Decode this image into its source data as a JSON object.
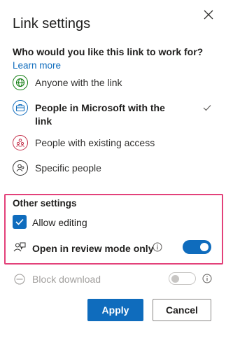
{
  "dialog": {
    "title": "Link settings",
    "question": "Who would you like this link to work for?",
    "learn_more": "Learn more"
  },
  "options": [
    {
      "label": "Anyone with the link",
      "icon": "globe-icon",
      "color": "#107c10",
      "selected": false
    },
    {
      "label": "People in Microsoft with the link",
      "icon": "briefcase-icon",
      "color": "#0f6cbd",
      "selected": true
    },
    {
      "label": "People with existing access",
      "icon": "people-group-icon",
      "color": "#c4314b",
      "selected": false
    },
    {
      "label": "Specific people",
      "icon": "person-icon",
      "color": "#323130",
      "selected": false
    }
  ],
  "other_settings": {
    "heading": "Other settings",
    "allow_editing": {
      "label": "Allow editing",
      "checked": true
    },
    "review_mode": {
      "label": "Open in review mode only",
      "on": true
    },
    "block_download": {
      "label": "Block download",
      "on": false,
      "disabled": true
    }
  },
  "buttons": {
    "apply": "Apply",
    "cancel": "Cancel"
  },
  "colors": {
    "accent": "#0f6cbd",
    "highlight": "#e3417a",
    "disabled": "#a19f9d"
  }
}
